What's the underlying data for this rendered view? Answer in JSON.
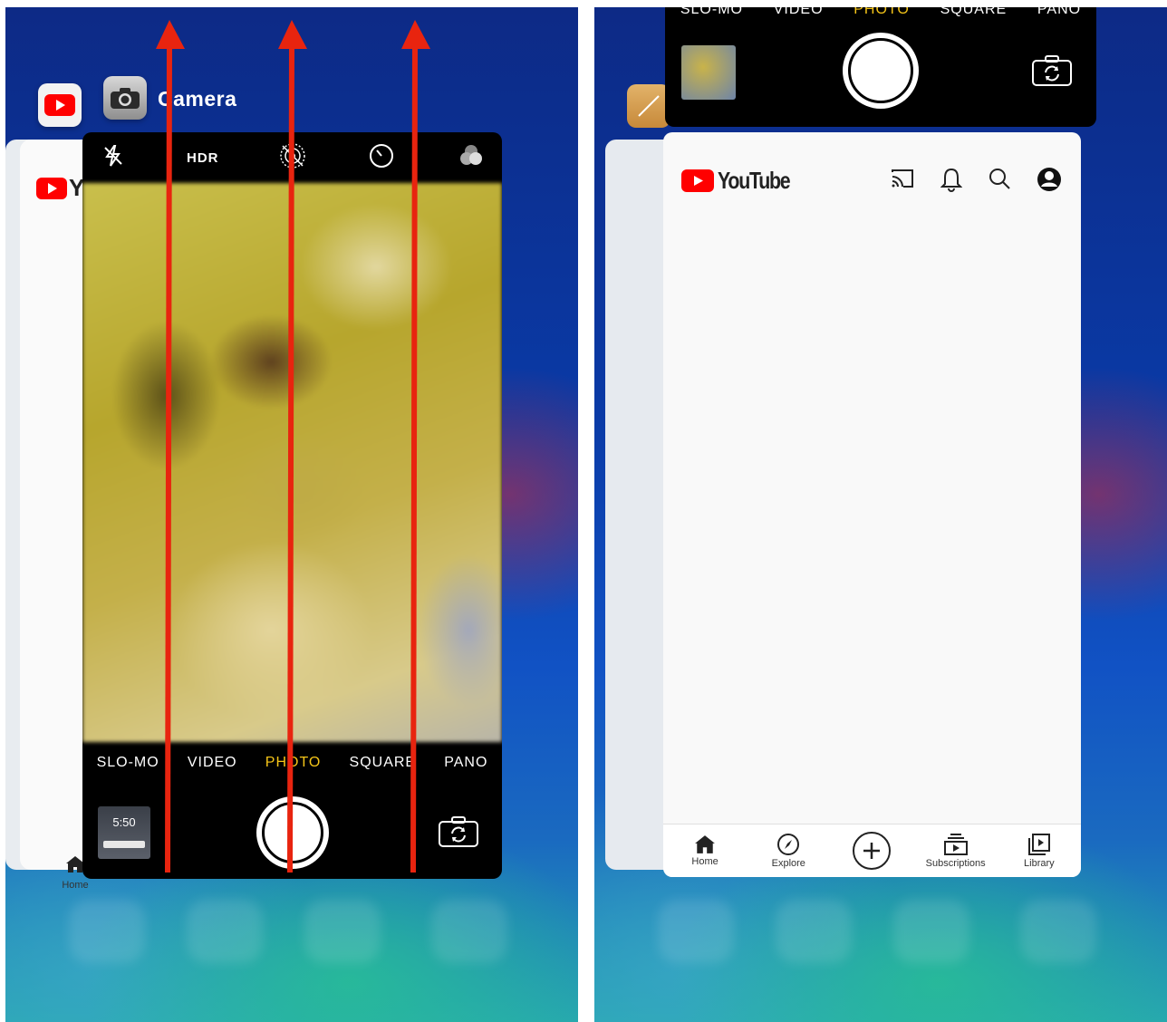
{
  "left_panel": {
    "camera_app_title": "Camera",
    "youtube_card": {
      "home_label": "Home",
      "logo_letter": "Y"
    },
    "camera": {
      "top_bar": {
        "hdr_label": "HDR"
      },
      "modes": [
        "SLO-MO",
        "VIDEO",
        "PHOTO",
        "SQUARE",
        "PANO"
      ],
      "active_mode": "PHOTO",
      "thumbnail_time": "5:50"
    },
    "arrows": {
      "count": 3,
      "color": "#e8240f",
      "direction": "up"
    }
  },
  "right_panel": {
    "camera": {
      "modes": [
        "SLO-MO",
        "VIDEO",
        "PHOTO",
        "SQUARE",
        "PANO"
      ],
      "active_mode": "PHOTO"
    },
    "youtube": {
      "wordmark": "YouTube",
      "header_icons": [
        "cast-icon",
        "bell-icon",
        "search-icon",
        "account-icon"
      ],
      "tabs": [
        {
          "label": "Home",
          "icon": "home-icon"
        },
        {
          "label": "Explore",
          "icon": "compass-icon"
        },
        {
          "label": "",
          "icon": "create-plus-icon"
        },
        {
          "label": "Subscriptions",
          "icon": "subscriptions-icon"
        },
        {
          "label": "Library",
          "icon": "library-icon"
        }
      ]
    }
  },
  "colors": {
    "youtube_red": "#ff0000",
    "camera_active_mode": "#f5c518",
    "arrow_red": "#e8240f"
  }
}
